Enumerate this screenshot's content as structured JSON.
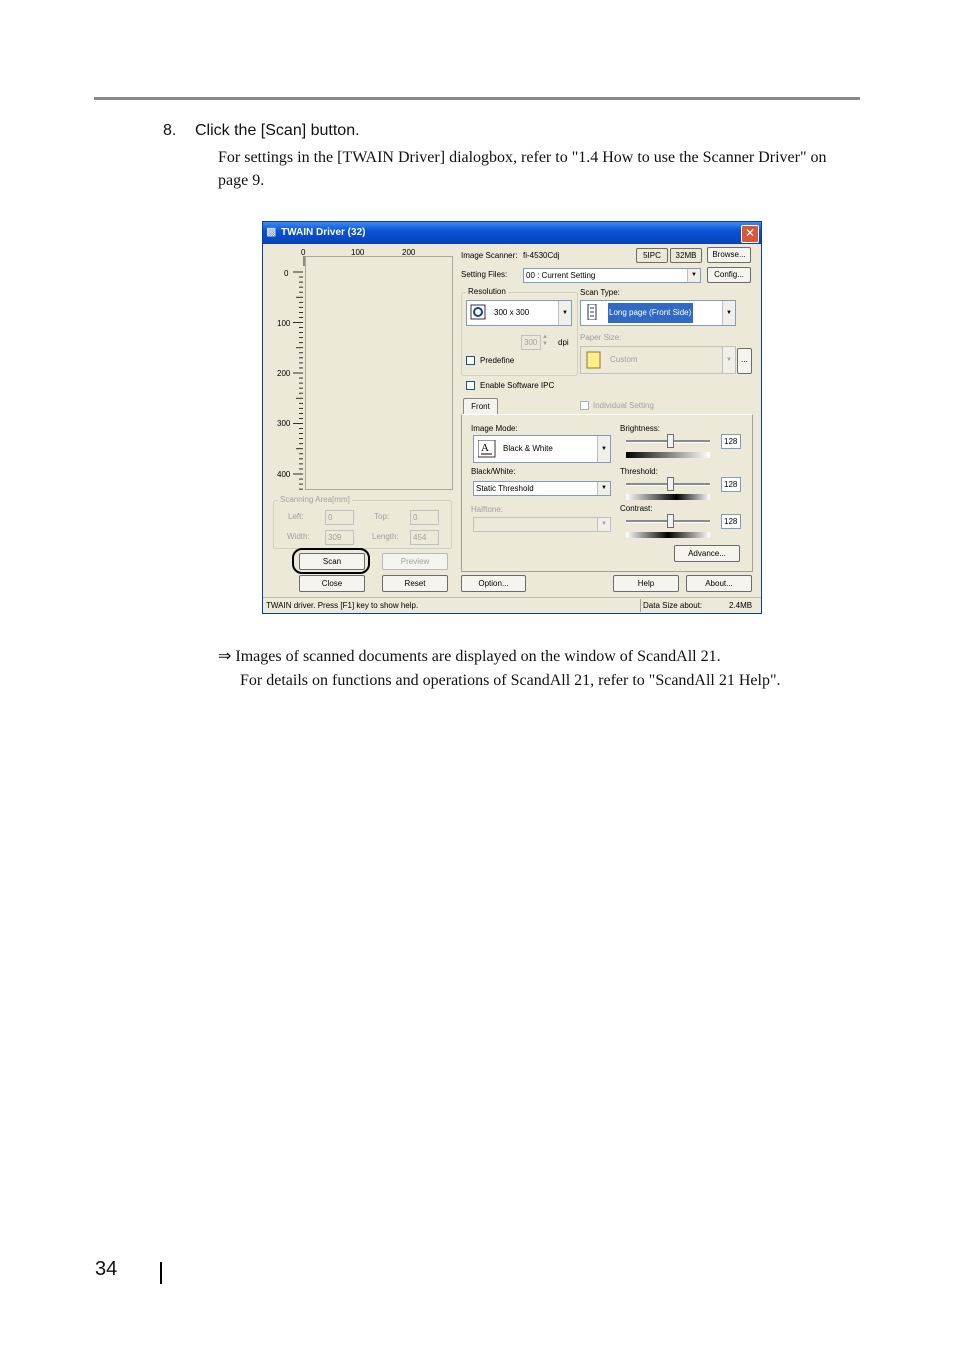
{
  "step": {
    "number": "8.",
    "text": "Click the [Scan] button."
  },
  "paragraph": "For settings in the [TWAIN Driver] dialogbox, refer to \"1.4 How to use the Scanner Driver\" on page 9.",
  "result": {
    "arrow": "⇒",
    "line1": "Images of scanned documents are displayed on the window of ScandAll 21.",
    "line2": "For details on functions and operations of ScandAll 21, refer to \"ScandAll 21 Help\"."
  },
  "page_number": "34",
  "dialog": {
    "title": "TWAIN Driver (32)",
    "close_glyph": "✕",
    "ruler": {
      "top_ticks": [
        "0",
        "100",
        "200"
      ],
      "left_ticks": [
        "0",
        "100",
        "200",
        "300",
        "400"
      ]
    },
    "scanning_area": {
      "label": "Scanning Area[mm]",
      "left_label": "Left:",
      "left_value": "0",
      "top_label": "Top:",
      "top_value": "0",
      "width_label": "Width:",
      "width_value": "309",
      "length_label": "Length:",
      "length_value": "454"
    },
    "buttons": {
      "scan": "Scan",
      "preview": "Preview",
      "close": "Close",
      "reset": "Reset",
      "option": "Option...",
      "help": "Help",
      "about": "About...",
      "browse": "Browse...",
      "config": "Config...",
      "advance": "Advance...",
      "paper_more": "..."
    },
    "image_scanner": {
      "label": "Image Scanner:",
      "value": "fi-4530Cdj",
      "badge1": "5IPC",
      "badge2": "32MB"
    },
    "setting_files": {
      "label": "Setting Files:",
      "value": "00 : Current Setting"
    },
    "resolution": {
      "label": "Resolution",
      "value": "300 x 300",
      "custom_value": "300",
      "unit": "dpi",
      "predefine": "Predefine"
    },
    "scan_type": {
      "label": "Scan Type:",
      "value": "Long page (Front Side)"
    },
    "paper_size": {
      "label": "Paper Size:",
      "value": "Custom"
    },
    "enable_ipc": "Enable Software IPC",
    "tab_front": "Front",
    "individual_setting": "Individual Setting",
    "image_mode": {
      "label": "Image Mode:",
      "value": "Black & White"
    },
    "black_white": {
      "label": "Black/White:",
      "value": "Static Threshold"
    },
    "halftone": {
      "label": "Halftone:"
    },
    "brightness": {
      "label": "Brightness:",
      "value": "128"
    },
    "threshold": {
      "label": "Threshold:",
      "value": "128"
    },
    "contrast": {
      "label": "Contrast:",
      "value": "128"
    },
    "status": {
      "hint": "TWAIN driver. Press [F1] key to show help.",
      "data_size_label": "Data Size about:",
      "data_size_value": "2.4MB"
    }
  },
  "colors": {
    "titlebar": "#0a52d6",
    "dialog_bg": "#ece9d8",
    "highlight_ring": "#000000",
    "rule": "#8a8a8a"
  },
  "icons": [
    "scanner-icon",
    "resolution-icon",
    "scan-type-icon",
    "paper-icon",
    "image-mode-icon"
  ]
}
